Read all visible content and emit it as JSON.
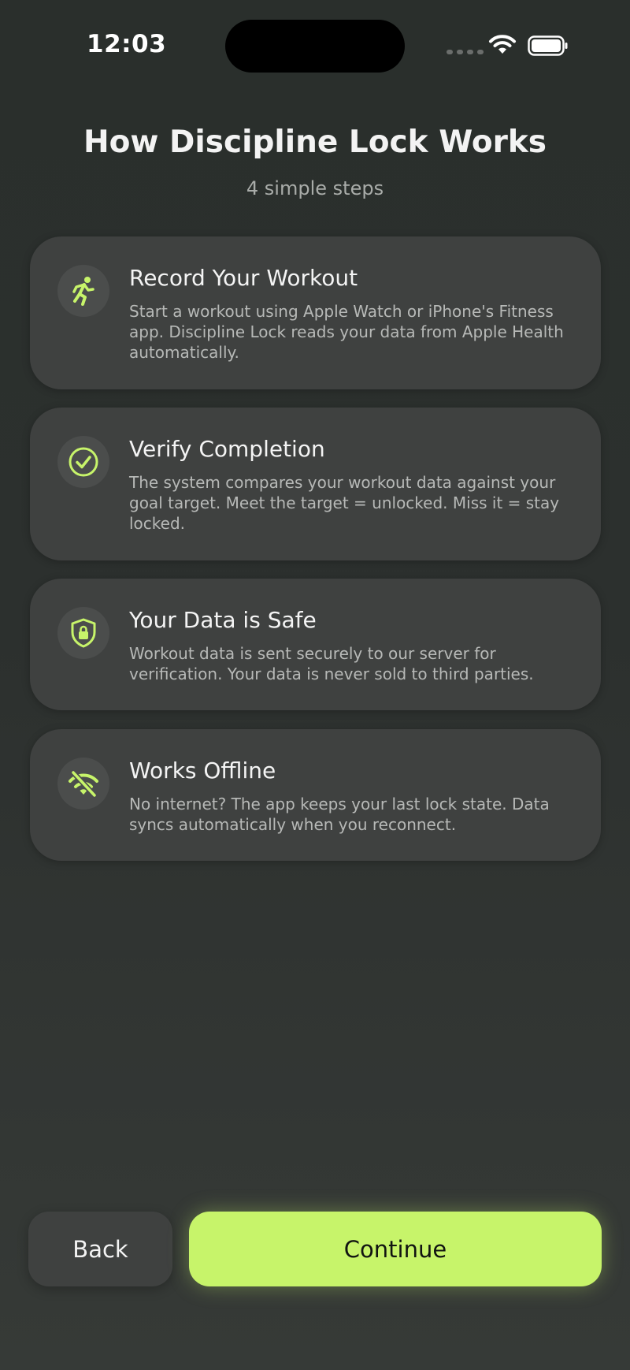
{
  "status_bar": {
    "time": "12:03"
  },
  "header": {
    "title": "How Discipline Lock Works",
    "subtitle": "4 simple steps"
  },
  "accent_color": "#c7f46a",
  "steps": [
    {
      "icon": "running-figure-icon",
      "title": "Record Your Workout",
      "description": "Start a workout using Apple Watch or iPhone's Fitness app. Discipline Lock reads your data from Apple Health automatically."
    },
    {
      "icon": "checkmark-circle-icon",
      "title": "Verify Completion",
      "description": "The system compares your workout data against your goal target. Meet the target = unlocked. Miss it = stay locked."
    },
    {
      "icon": "lock-shield-icon",
      "title": "Your Data is Safe",
      "description": "Workout data is sent securely to our server for verification. Your data is never sold to third parties."
    },
    {
      "icon": "wifi-slash-icon",
      "title": "Works Offline",
      "description": "No internet? The app keeps your last lock state. Data syncs automatically when you reconnect."
    }
  ],
  "footer": {
    "back_label": "Back",
    "continue_label": "Continue"
  }
}
